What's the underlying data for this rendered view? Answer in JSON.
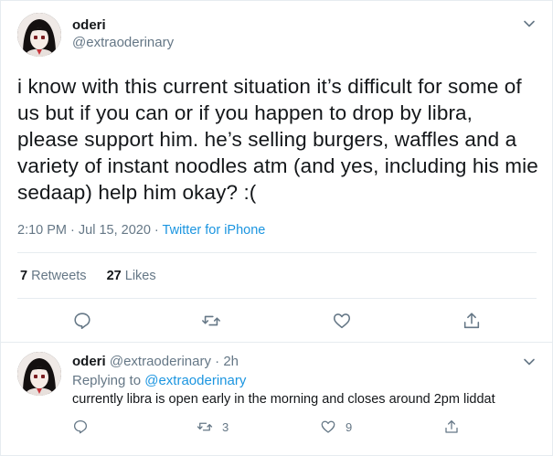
{
  "tweet": {
    "author": {
      "display_name": "oderi",
      "handle": "@extraoderinary"
    },
    "text": "i know with this current situation it’s difficult for some of us but if you can or if you happen to drop by libra, please support him. he’s selling burgers, waffles and a variety of instant noodles atm (and yes, including his mie sedaap) help him okay? :(",
    "time": "2:10 PM · Jul 15, 2020",
    "separator": " · ",
    "source": "Twitter for iPhone",
    "stats": {
      "retweets_count": "7",
      "retweets_label": "Retweets",
      "likes_count": "27",
      "likes_label": "Likes"
    },
    "icons": {
      "more": "chevron-down-icon",
      "reply": "reply-icon",
      "retweet": "retweet-icon",
      "like": "heart-icon",
      "share": "share-icon"
    }
  },
  "reply": {
    "author": {
      "display_name": "oderi",
      "handle": "@extraoderinary",
      "age": "2h"
    },
    "meta_sep": " · ",
    "replying_prefix": "Replying to ",
    "replying_to": "@extraoderinary",
    "text": "currently libra is open early in the morning and closes around 2pm liddat",
    "retweets": "3",
    "likes": "9"
  },
  "colors": {
    "accent": "#1b95e0",
    "secondary_text": "#657786",
    "primary_text": "#14171a",
    "divider": "#e6ecf0"
  }
}
